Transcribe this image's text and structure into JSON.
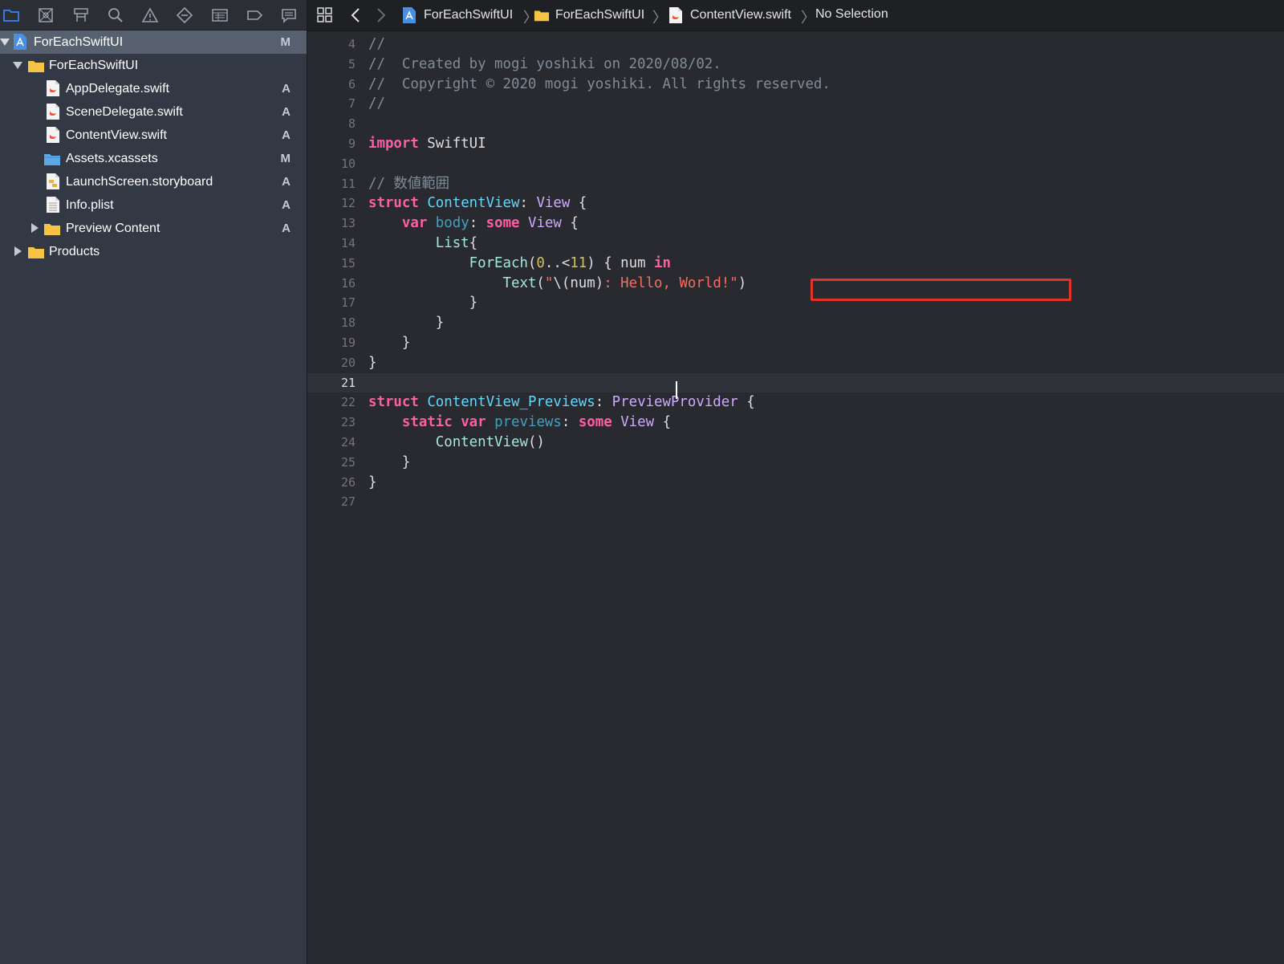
{
  "navigator": {
    "toolbar_icons": [
      "project-navigator-icon",
      "source-control-icon",
      "symbol-navigator-icon",
      "find-icon",
      "issue-icon",
      "test-icon",
      "debug-icon",
      "breakpoint-icon",
      "report-icon"
    ],
    "items": [
      {
        "label": "ForEachSwiftUI",
        "status": "M",
        "icon": "project-icon",
        "disclosure": "open",
        "indent": 0,
        "selected": true
      },
      {
        "label": "ForEachSwiftUI",
        "status": "",
        "icon": "folder-icon",
        "disclosure": "open",
        "indent": 1
      },
      {
        "label": "AppDelegate.swift",
        "status": "A",
        "icon": "swift-file-icon",
        "disclosure": "none",
        "indent": 2
      },
      {
        "label": "SceneDelegate.swift",
        "status": "A",
        "icon": "swift-file-icon",
        "disclosure": "none",
        "indent": 2
      },
      {
        "label": "ContentView.swift",
        "status": "A",
        "icon": "swift-file-icon",
        "disclosure": "none",
        "indent": 2
      },
      {
        "label": "Assets.xcassets",
        "status": "M",
        "icon": "asset-catalog-icon",
        "disclosure": "none",
        "indent": 2
      },
      {
        "label": "LaunchScreen.storyboard",
        "status": "A",
        "icon": "storyboard-icon",
        "disclosure": "none",
        "indent": 2
      },
      {
        "label": "Info.plist",
        "status": "A",
        "icon": "plist-icon",
        "disclosure": "none",
        "indent": 2
      },
      {
        "label": "Preview Content",
        "status": "A",
        "icon": "folder-icon",
        "disclosure": "closed",
        "indent": 2
      },
      {
        "label": "Products",
        "status": "",
        "icon": "folder-icon",
        "disclosure": "closed",
        "indent": 1
      }
    ]
  },
  "jumpbar": {
    "crumbs": [
      {
        "label": "ForEachSwiftUI",
        "icon": "project-icon"
      },
      {
        "label": "ForEachSwiftUI",
        "icon": "folder-icon"
      },
      {
        "label": "ContentView.swift",
        "icon": "swift-file-icon"
      },
      {
        "label": "No Selection",
        "icon": ""
      }
    ]
  },
  "editor": {
    "current_line": 21,
    "highlighted_line": 16,
    "lines": [
      {
        "num": "4",
        "tokens": [
          [
            "comment",
            "//"
          ]
        ]
      },
      {
        "num": "5",
        "tokens": [
          [
            "comment",
            "//  Created by mogi yoshiki on 2020/08/02."
          ]
        ]
      },
      {
        "num": "6",
        "tokens": [
          [
            "comment",
            "//  Copyright © 2020 mogi yoshiki. All rights reserved."
          ]
        ]
      },
      {
        "num": "7",
        "tokens": [
          [
            "comment",
            "//"
          ]
        ]
      },
      {
        "num": "8",
        "tokens": []
      },
      {
        "num": "9",
        "tokens": [
          [
            "kw",
            "import"
          ],
          [
            "plain",
            " SwiftUI"
          ]
        ]
      },
      {
        "num": "10",
        "tokens": []
      },
      {
        "num": "11",
        "tokens": [
          [
            "comment",
            "// 数値範囲"
          ]
        ]
      },
      {
        "num": "12",
        "tokens": [
          [
            "kw",
            "struct"
          ],
          [
            "plain",
            " "
          ],
          [
            "decl",
            "ContentView"
          ],
          [
            "plain",
            ": "
          ],
          [
            "type",
            "View"
          ],
          [
            "plain",
            " {"
          ]
        ]
      },
      {
        "num": "13",
        "tokens": [
          [
            "plain",
            "    "
          ],
          [
            "kw",
            "var"
          ],
          [
            "plain",
            " "
          ],
          [
            "var",
            "body"
          ],
          [
            "plain",
            ": "
          ],
          [
            "kw",
            "some"
          ],
          [
            "plain",
            " "
          ],
          [
            "type",
            "View"
          ],
          [
            "plain",
            " {"
          ]
        ]
      },
      {
        "num": "14",
        "tokens": [
          [
            "plain",
            "        "
          ],
          [
            "func",
            "List"
          ],
          [
            "plain",
            "{"
          ]
        ]
      },
      {
        "num": "15",
        "tokens": [
          [
            "plain",
            "            "
          ],
          [
            "func",
            "ForEach"
          ],
          [
            "plain",
            "("
          ],
          [
            "num",
            "0"
          ],
          [
            "plain",
            "..<"
          ],
          [
            "num",
            "11"
          ],
          [
            "plain",
            ") { num "
          ],
          [
            "kw",
            "in"
          ]
        ]
      },
      {
        "num": "16",
        "tokens": [
          [
            "plain",
            "                "
          ],
          [
            "func",
            "Text"
          ],
          [
            "plain",
            "("
          ],
          [
            "str",
            "\""
          ],
          [
            "plain",
            "\\(num)"
          ],
          [
            "str",
            ": Hello, World!\""
          ],
          [
            "plain",
            ")"
          ]
        ]
      },
      {
        "num": "17",
        "tokens": [
          [
            "plain",
            "            }"
          ]
        ]
      },
      {
        "num": "18",
        "tokens": [
          [
            "plain",
            "        }"
          ]
        ]
      },
      {
        "num": "19",
        "tokens": [
          [
            "plain",
            "    }"
          ]
        ]
      },
      {
        "num": "20",
        "tokens": [
          [
            "plain",
            "}"
          ]
        ]
      },
      {
        "num": "21",
        "tokens": []
      },
      {
        "num": "22",
        "tokens": [
          [
            "kw",
            "struct"
          ],
          [
            "plain",
            " "
          ],
          [
            "decl",
            "ContentView_Previews"
          ],
          [
            "plain",
            ": "
          ],
          [
            "type",
            "PreviewProvider"
          ],
          [
            "plain",
            " {"
          ]
        ]
      },
      {
        "num": "23",
        "tokens": [
          [
            "plain",
            "    "
          ],
          [
            "kw",
            "static"
          ],
          [
            "plain",
            " "
          ],
          [
            "kw",
            "var"
          ],
          [
            "plain",
            " "
          ],
          [
            "var",
            "previews"
          ],
          [
            "plain",
            ": "
          ],
          [
            "kw",
            "some"
          ],
          [
            "plain",
            " "
          ],
          [
            "type",
            "View"
          ],
          [
            "plain",
            " {"
          ]
        ]
      },
      {
        "num": "24",
        "tokens": [
          [
            "plain",
            "        "
          ],
          [
            "func",
            "ContentView"
          ],
          [
            "plain",
            "()"
          ]
        ]
      },
      {
        "num": "25",
        "tokens": [
          [
            "plain",
            "    }"
          ]
        ]
      },
      {
        "num": "26",
        "tokens": [
          [
            "plain",
            "}"
          ]
        ]
      },
      {
        "num": "27",
        "tokens": []
      }
    ]
  },
  "colors": {
    "accent": "#3b82f6",
    "highlight_box": "#e0342b",
    "keyword": "#fc5fa3",
    "string": "#fc6a5d",
    "comment": "#7f8c98"
  }
}
